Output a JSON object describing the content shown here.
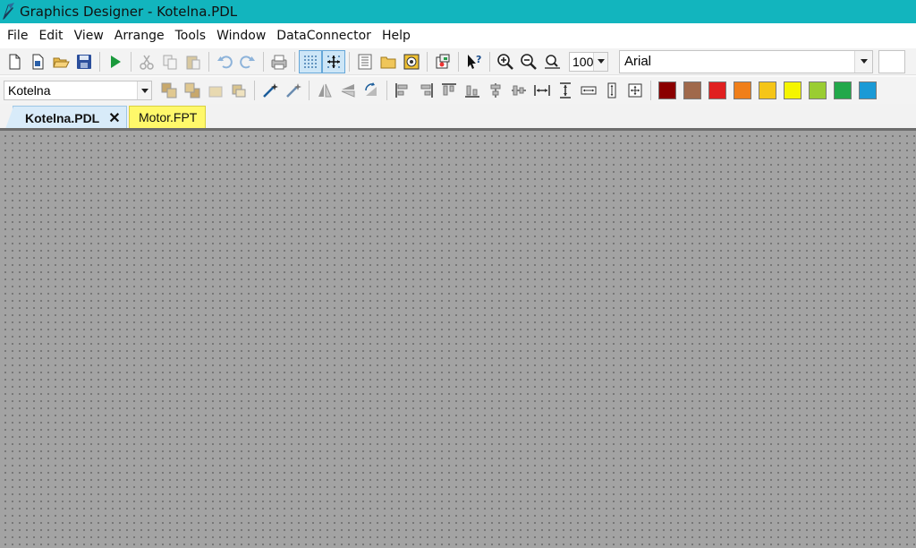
{
  "window": {
    "title": "Graphics Designer - Kotelna.PDL"
  },
  "menu": {
    "items": [
      "File",
      "Edit",
      "View",
      "Arrange",
      "Tools",
      "Window",
      "DataConnector",
      "Help"
    ]
  },
  "toolbar": {
    "zoom_value": "100",
    "font_name": "Arial",
    "icons": [
      "new-icon",
      "new-faceplate-icon",
      "open-icon",
      "save-icon",
      "run-icon",
      "cut-icon",
      "copy-icon",
      "paste-icon",
      "undo-icon",
      "redo-icon",
      "print-icon",
      "grid-icon",
      "snap-icon",
      "library-icon",
      "folder-icon",
      "object-icon",
      "dynamic-icon",
      "help-cursor-icon",
      "zoom-in-icon",
      "zoom-out-icon",
      "zoom-fit-icon"
    ]
  },
  "toolbar2": {
    "layer_value": "Kotelna",
    "colors": [
      "#8b0000",
      "#a0694b",
      "#e02020",
      "#f07f1a",
      "#f5c518",
      "#f5f500",
      "#9acd32",
      "#22a84a",
      "#1a9ad6"
    ]
  },
  "tabs": [
    {
      "label": "Kotelna.PDL",
      "active": true
    },
    {
      "label": "Motor.FPT",
      "active": false
    }
  ]
}
